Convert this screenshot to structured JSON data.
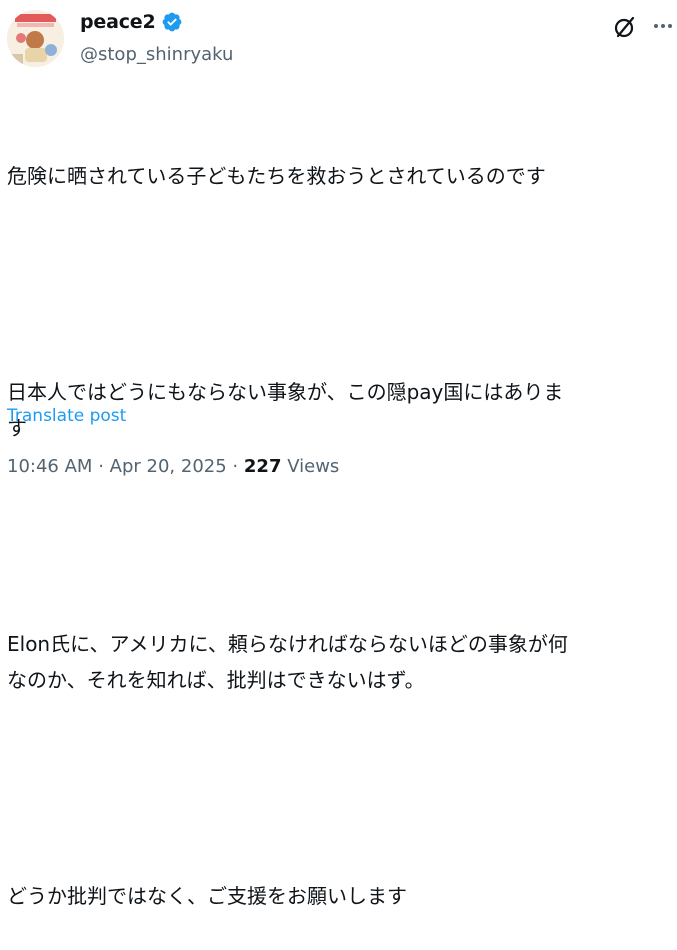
{
  "author": {
    "display_name": "peace2",
    "handle": "@stop_shinryaku",
    "verified_icon": "verified-badge-icon",
    "badge_color": "#1d9bf0"
  },
  "tweet": {
    "paragraphs": [
      "危険に晒されている子どもたちを救おうとされているのです",
      "日本人ではどうにもならない事象が、この隠pay国にはありま\nす",
      "Elon氏に、アメリカに、頼らなければならないほどの事象が何\nなのか、それを知れば、批判はできないはず。",
      "どうか批判ではなく、ご支援をお願いします"
    ],
    "translate_label": "Translate post",
    "time": "10:46 AM",
    "separator": "·",
    "date": "Apr 20, 2025",
    "views_count": "227",
    "views_label": "Views"
  },
  "icons": {
    "grok": "grok-icon",
    "more": "more-icon"
  },
  "colors": {
    "link": "#1d9bf0",
    "secondary_text": "#536471",
    "primary_text": "#0f1419"
  }
}
